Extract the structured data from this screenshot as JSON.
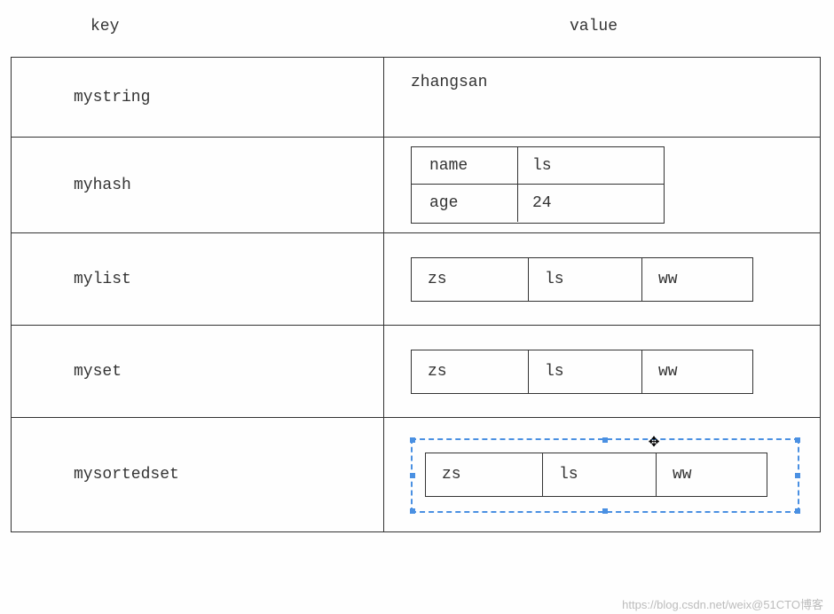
{
  "header": {
    "key_label": "key",
    "value_label": "value"
  },
  "rows": {
    "mystring": {
      "key": "mystring",
      "value": "zhangsan"
    },
    "myhash": {
      "key": "myhash",
      "fields": [
        {
          "k": "name",
          "v": "ls"
        },
        {
          "k": "age",
          "v": "24"
        }
      ]
    },
    "mylist": {
      "key": "mylist",
      "items": [
        "zs",
        "ls",
        "ww"
      ]
    },
    "myset": {
      "key": "myset",
      "items": [
        "zs",
        "ls",
        "ww"
      ]
    },
    "mysortedset": {
      "key": "mysortedset",
      "items": [
        "zs",
        "ls",
        "ww"
      ]
    }
  },
  "watermark": "https://blog.csdn.net/weix@51CTO博客"
}
